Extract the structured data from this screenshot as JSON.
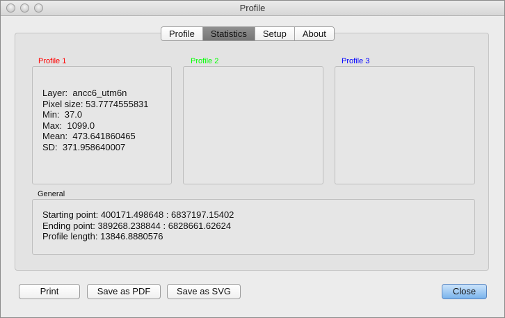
{
  "window": {
    "title": "Profile"
  },
  "tabs": [
    {
      "label": "Profile",
      "active": false
    },
    {
      "label": "Statistics",
      "active": true
    },
    {
      "label": "Setup",
      "active": false
    },
    {
      "label": "About",
      "active": false
    }
  ],
  "profiles": [
    {
      "label": "Profile 1",
      "color": "#ff0000",
      "lines": [
        "Layer:  ancc6_utm6n",
        "Pixel size: 53.7774555831",
        "Min:  37.0",
        "Max:  1099.0",
        "Mean:  473.641860465",
        "SD:  371.958640007"
      ]
    },
    {
      "label": "Profile 2",
      "color": "#00ff00",
      "lines": []
    },
    {
      "label": "Profile 3",
      "color": "#0000ff",
      "lines": []
    }
  ],
  "general": {
    "label": "General",
    "lines": [
      "Starting point: 400171.498648 : 6837197.15402",
      "Ending point: 389268.238844 : 6828661.62624",
      "Profile length: 13846.8880576"
    ]
  },
  "buttons": {
    "print": "Print",
    "save_pdf": "Save as PDF",
    "save_svg": "Save as SVG",
    "close": "Close"
  }
}
